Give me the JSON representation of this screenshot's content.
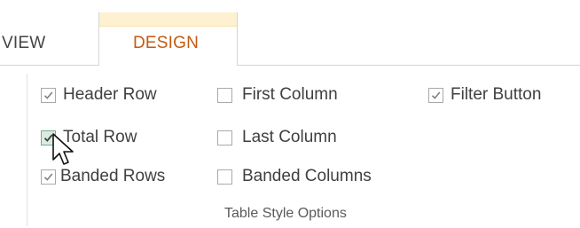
{
  "tabs": {
    "view_label": "VIEW",
    "design_label": "DESIGN",
    "active": "DESIGN",
    "design_accent_color": "#fdf1d2",
    "design_text_color": "#c55a11"
  },
  "group": {
    "label": "Table Style Options",
    "options": [
      {
        "label": "Header Row",
        "checked": true
      },
      {
        "label": "Total Row",
        "checked": true,
        "hovered": true
      },
      {
        "label": "Banded Rows",
        "checked": true
      },
      {
        "label": "First Column",
        "checked": false
      },
      {
        "label": "Last Column",
        "checked": false
      },
      {
        "label": "Banded Columns",
        "checked": false
      },
      {
        "label": "Filter Button",
        "checked": true
      }
    ]
  },
  "pointer": {
    "icon": "mouse-pointer-icon"
  }
}
